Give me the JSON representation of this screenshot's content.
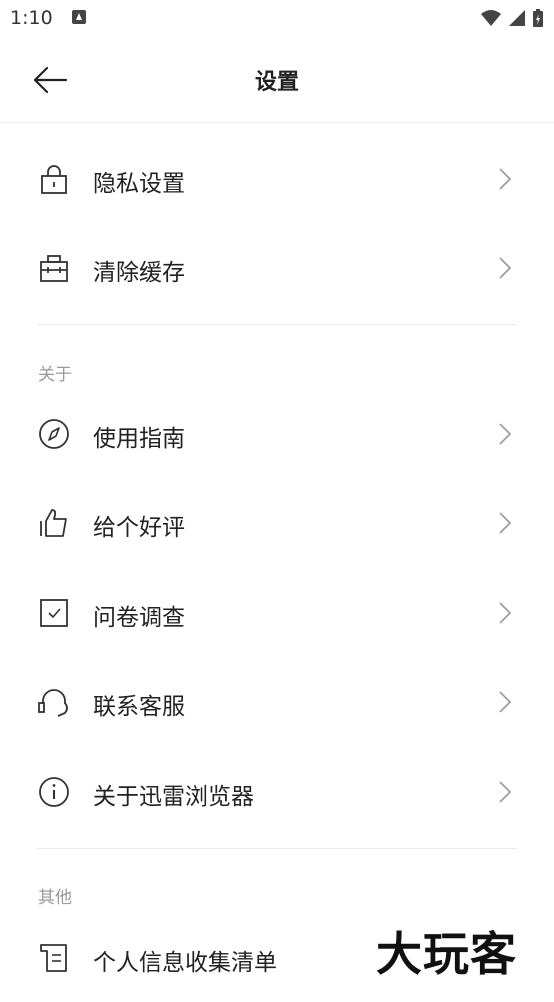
{
  "status_bar": {
    "time": "1:10"
  },
  "header": {
    "title": "设置"
  },
  "rows": {
    "privacy": "隐私设置",
    "clear_cache": "清除缓存",
    "guide": "使用指南",
    "rate": "给个好评",
    "survey": "问卷调查",
    "support": "联系客服",
    "about": "关于迅雷浏览器",
    "personal_info": "个人信息收集清单"
  },
  "sections": {
    "about": "关于",
    "other": "其他"
  },
  "watermark": "大玩客",
  "colors": {
    "icon_stroke": "#333333",
    "chevron": "#9e9e9e",
    "section_text": "#9a9a9a",
    "divider": "#ececec"
  }
}
